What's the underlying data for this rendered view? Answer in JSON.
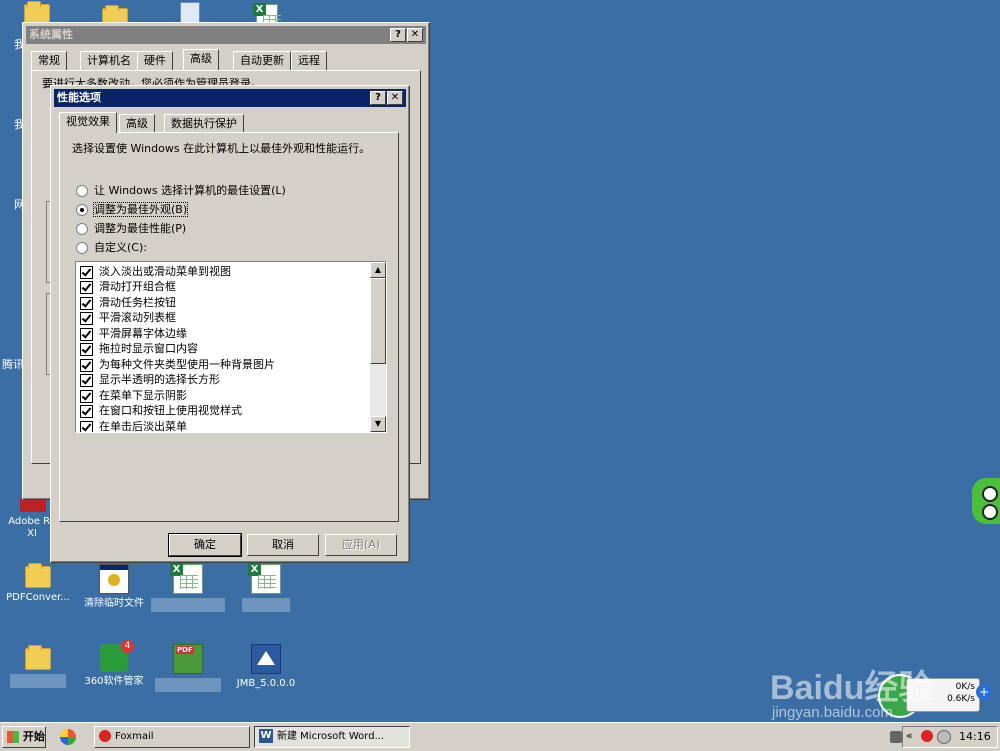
{
  "desktop_icons": [
    {
      "id": "pdfconv",
      "label": "PDFConver...",
      "type": "folder"
    },
    {
      "id": "cleaner",
      "label": "清除临时文件",
      "type": "app"
    },
    {
      "id": "xls3",
      "label": "",
      "type": "xls"
    },
    {
      "id": "xls4",
      "label": "",
      "type": "xls"
    },
    {
      "id": "folder2",
      "label": "",
      "type": "folder"
    },
    {
      "id": "soft360",
      "label": "360软件管家",
      "type": "app",
      "badge": "4"
    },
    {
      "id": "pdfapp",
      "label": "",
      "type": "pdf"
    },
    {
      "id": "jmb",
      "label": "JMB_5.0.0.0",
      "type": "app"
    },
    {
      "id": "adobe",
      "label": "Adobe Re XI"
    },
    {
      "id": "partial1",
      "label": "我"
    },
    {
      "id": "partial2",
      "label": "我"
    },
    {
      "id": "partial3",
      "label": "网"
    },
    {
      "id": "partial4",
      "label": "腾讯"
    }
  ],
  "sys_window": {
    "title": "系统属性",
    "help_btn": "?",
    "close_btn": "✕",
    "tabs": [
      "常规",
      "计算机名",
      "硬件",
      "高级",
      "自动更新",
      "远程"
    ],
    "selected_tab": "高级",
    "partial_text": "要进行大多数改动，您必须作为管理员登录。"
  },
  "perf_dialog": {
    "title": "性能选项",
    "help_btn": "?",
    "close_btn": "✕",
    "tabs": [
      "视觉效果",
      "高级",
      "数据执行保护"
    ],
    "selected_tab": "视觉效果",
    "description": "选择设置使 Windows 在此计算机上以最佳外观和性能运行。",
    "radios": [
      {
        "label": "让 Windows 选择计算机的最佳设置(L)",
        "checked": false
      },
      {
        "label": "调整为最佳外观(B)",
        "checked": true
      },
      {
        "label": "调整为最佳性能(P)",
        "checked": false
      },
      {
        "label": "自定义(C):",
        "checked": false
      }
    ],
    "effects": [
      "淡入淡出或滑动菜单到视图",
      "滑动打开组合框",
      "滑动任务栏按钮",
      "平滑滚动列表框",
      "平滑屏幕字体边缘",
      "拖拉时显示窗口内容",
      "为每种文件夹类型使用一种背景图片",
      "显示半透明的选择长方形",
      "在菜单下显示阴影",
      "在窗口和按钮上使用视觉样式",
      "在单击后淡出菜单"
    ],
    "buttons": {
      "ok": "确定",
      "cancel": "取消",
      "apply": "应用(A)"
    }
  },
  "taskbar": {
    "start_label": "开始",
    "items": [
      {
        "label": "Foxmail",
        "pressed": false
      },
      {
        "label": "新建 Microsoft Word...",
        "pressed": true
      }
    ],
    "clock": "14:16"
  },
  "netmeter": {
    "up": "0K/s",
    "down": "0.6K/s"
  },
  "watermark": {
    "brand": "Baidu经验",
    "url": "jingyan.baidu.com"
  }
}
